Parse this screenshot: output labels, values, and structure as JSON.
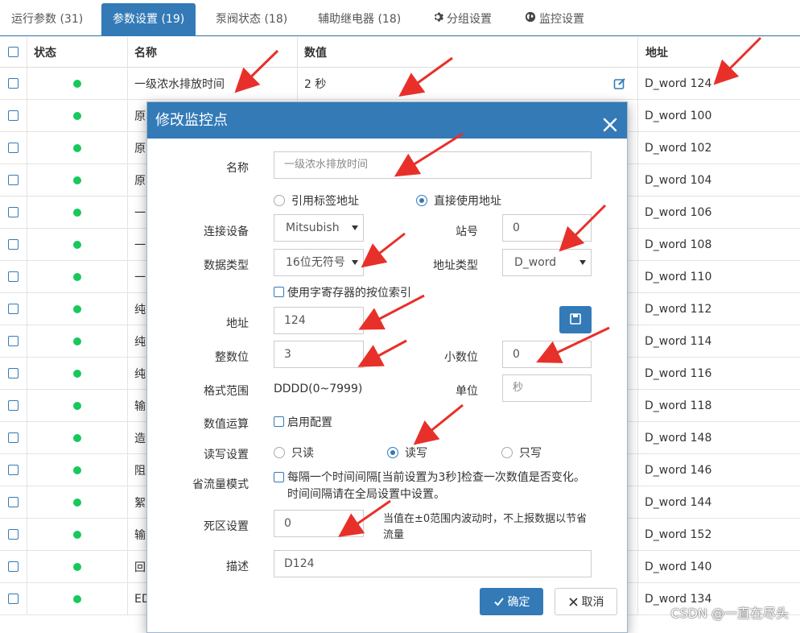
{
  "tabs": [
    {
      "label": "运行参数 (31)"
    },
    {
      "label": "参数设置 (19)"
    },
    {
      "label": "泵阀状态 (18)"
    },
    {
      "label": "辅助继电器 (18)"
    },
    {
      "label": "分组设置",
      "icon": "gear-icon"
    },
    {
      "label": "监控设置",
      "icon": "globe-icon"
    }
  ],
  "table": {
    "headers": {
      "status": "状态",
      "name": "名称",
      "value": "数值",
      "address": "地址"
    },
    "rows": [
      {
        "name": "一级浓水排放时间",
        "value": "2 秒",
        "address": "D_word 124"
      },
      {
        "name": "原",
        "value": "",
        "address": "D_word 100"
      },
      {
        "name": "原",
        "value": "",
        "address": "D_word 102"
      },
      {
        "name": "原",
        "value": "",
        "address": "D_word 104"
      },
      {
        "name": "一",
        "value": "",
        "address": "D_word 106"
      },
      {
        "name": "一",
        "value": "",
        "address": "D_word 108"
      },
      {
        "name": "一",
        "value": "",
        "address": "D_word 110"
      },
      {
        "name": "纯",
        "value": "",
        "address": "D_word 112"
      },
      {
        "name": "纯",
        "value": "",
        "address": "D_word 114"
      },
      {
        "name": "纯",
        "value": "",
        "address": "D_word 116"
      },
      {
        "name": "输",
        "value": "",
        "address": "D_word 118"
      },
      {
        "name": "造",
        "value": "",
        "address": "D_word 148"
      },
      {
        "name": "阻",
        "value": "",
        "address": "D_word 146"
      },
      {
        "name": "絮",
        "value": "",
        "address": "D_word 144"
      },
      {
        "name": "输",
        "value": "",
        "address": "D_word 152"
      },
      {
        "name": "回",
        "value": "",
        "address": "D_word 140"
      },
      {
        "name": "ED",
        "value": "",
        "address": "D_word 134"
      }
    ]
  },
  "modal": {
    "title": "修改监控点",
    "name_label": "名称",
    "name_placeholder": "一级浓水排放时间",
    "address_mode": {
      "tag": "引用标签地址",
      "direct": "直接使用地址",
      "selected": "direct"
    },
    "device_label": "连接设备",
    "device_value": "Mitsubish",
    "station_label": "站号",
    "station_value": "0",
    "datatype_label": "数据类型",
    "datatype_value": "16位无符号",
    "addrtype_label": "地址类型",
    "addrtype_value": "D_word",
    "bitindex_label": "使用字寄存器的按位索引",
    "addr_label": "地址",
    "addr_value": "124",
    "int_label": "整数位",
    "int_value": "3",
    "dec_label": "小数位",
    "dec_value": "0",
    "range_label": "格式范围",
    "range_value": "DDDD(0~7999)",
    "unit_label": "单位",
    "unit_value": "秒",
    "calc_label": "数值运算",
    "calc_enable": "启用配置",
    "rw_label": "读写设置",
    "rw_ro": "只读",
    "rw_rw": "读写",
    "rw_wo": "只写",
    "rw_selected": "rw",
    "flow_label": "省流量模式",
    "flow_text": "每隔一个时间间隔[当前设置为3秒]检查一次数值是否变化。时间间隔请在全局设置中设置。",
    "dead_label": "死区设置",
    "dead_value": "0",
    "dead_desc": "当值在±0范围内波动时，不上报数据以节省流量",
    "desc_label": "描述",
    "desc_value": "D124",
    "ok_label": "确定",
    "cancel_label": "取消"
  },
  "watermark": "CSDN @一直在尽头",
  "colors": {
    "primary": "#337ab7",
    "status_ok": "#19c85a",
    "annotation_arrow": "#e8302a"
  }
}
